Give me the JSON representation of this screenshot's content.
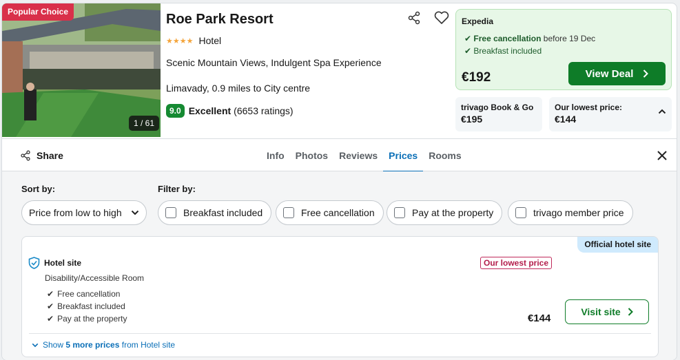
{
  "hotel": {
    "badge": "Popular Choice",
    "photo_counter": "1 / 61",
    "name": "Roe Park Resort",
    "stars": "★★★★",
    "type": "Hotel",
    "tagline": "Scenic Mountain Views, Indulgent Spa Experience",
    "location": "Limavady, 0.9 miles to City centre",
    "rating_score": "9.0",
    "rating_label": "Excellent",
    "rating_count": "(6653 ratings)"
  },
  "deal": {
    "provider": "Expedia",
    "free_cancel_bold": "Free cancellation",
    "free_cancel_rest": " before 19 Dec",
    "breakfast": "Breakfast included",
    "price": "€192",
    "button": "View Deal"
  },
  "alt_offers": [
    {
      "name": "trivago Book & Go",
      "price": "€195"
    },
    {
      "name": "Our lowest price:",
      "price": "€144"
    }
  ],
  "tabs_bar": {
    "share": "Share",
    "tabs": [
      "Info",
      "Photos",
      "Reviews",
      "Prices",
      "Rooms"
    ],
    "active_tab": "Prices"
  },
  "filters": {
    "sort_label": "Sort by:",
    "sort_value": "Price from low to high",
    "filter_label": "Filter by:",
    "chips": [
      "Breakfast included",
      "Free cancellation",
      "Pay at the property",
      "trivago member price"
    ]
  },
  "listing": {
    "official_badge": "Official hotel site",
    "site": "Hotel site",
    "room": "Disability/Accessible Room",
    "features": [
      "Free cancellation",
      "Breakfast included",
      "Pay at the property"
    ],
    "lowest_badge": "Our lowest price",
    "price": "€144",
    "button": "Visit site",
    "more_prefix": "Show ",
    "more_bold": "5 more prices",
    "more_suffix": " from Hotel site"
  },
  "colors": {
    "accent_green": "#0e7c28",
    "accent_blue": "#0a6fb7",
    "badge_red": "#d9304a"
  }
}
